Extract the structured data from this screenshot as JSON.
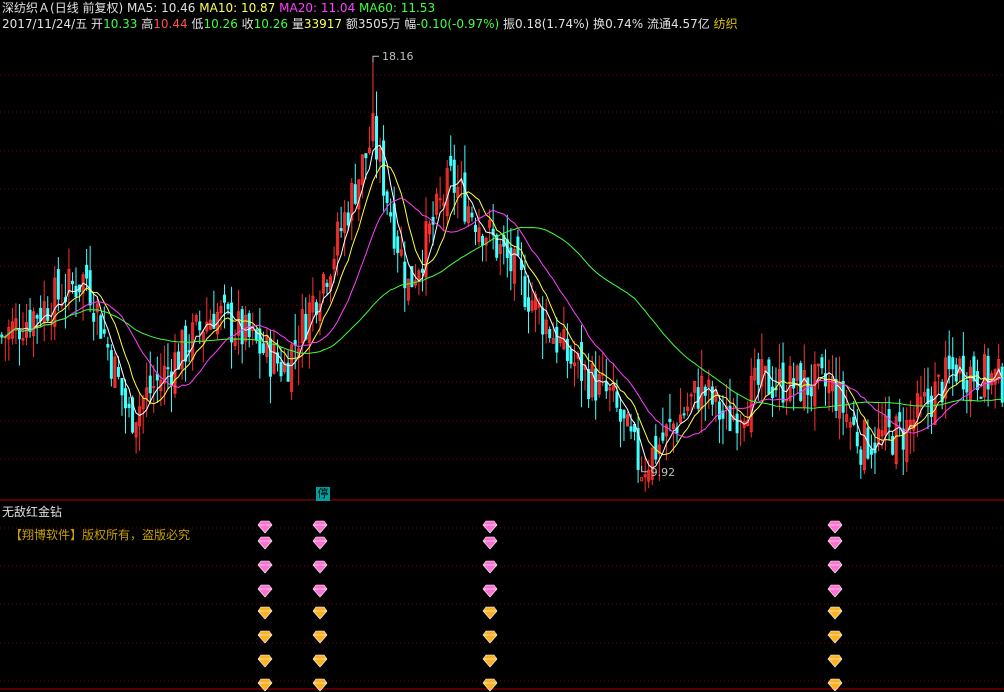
{
  "header": {
    "stock_name": "深纺织Ａ",
    "period": "(日线 前复权)",
    "ma5_label": "MA5: 10.46",
    "ma10_label": "MA10: 10.87",
    "ma20_label": "MA20: 11.04",
    "ma60_label": "MA60: 11.53",
    "date": "2017/11/24/五",
    "open_label": "开",
    "open_value": "10.33",
    "high_label": "高",
    "high_value": "10.44",
    "low_label": "低",
    "low_value": "10.26",
    "close_label": "收",
    "close_value": "10.26",
    "volume_label": "量",
    "volume_value": "33917",
    "amount_label": "额",
    "amount_value": "3505万",
    "change_label": "幅",
    "change_value": "-0.10(-0.97%)",
    "amplitude_label": "振",
    "amplitude_value": "0.18(1.74%)",
    "turnover_label": "换",
    "turnover_value": "0.74%",
    "float_label": "流通",
    "float_value": "4.57亿",
    "industry": "纺织"
  },
  "colors": {
    "up": "#ff3030",
    "down": "#40ffff",
    "ma5": "#ffffff",
    "ma10": "#ffff40",
    "ma20": "#ff40ff",
    "ma60": "#40ff40",
    "grid": "#800000",
    "divider": "#b00000",
    "gem_pink": "#ff70d0",
    "gem_gold": "#ffb020"
  },
  "sub_panel": {
    "title": "无敌红金钻",
    "copyright": "【翔博软件】版权所有，盗版必究",
    "stop_label": "停"
  },
  "chart_data": {
    "type": "candlestick",
    "high_annotation": "18.16",
    "low_annotation": "9.92",
    "ylim": [
      9.4,
      18.6
    ],
    "grid": true,
    "key_points": [
      {
        "index": 0,
        "close": 12.6
      },
      {
        "index": 24,
        "close": 13.8
      },
      {
        "index": 36,
        "close": 11.0
      },
      {
        "index": 60,
        "close": 13.1
      },
      {
        "index": 80,
        "close": 12.0
      },
      {
        "index": 94,
        "close": 14.3
      },
      {
        "index": 100,
        "close": 15.6
      },
      {
        "index": 105,
        "close": 16.6
      },
      {
        "index": 115,
        "close": 13.6
      },
      {
        "index": 127,
        "close": 15.7
      },
      {
        "index": 145,
        "close": 13.9
      },
      {
        "index": 160,
        "close": 12.2
      },
      {
        "index": 172,
        "close": 11.4
      },
      {
        "index": 181,
        "close": 10.0
      },
      {
        "index": 198,
        "close": 11.6
      },
      {
        "index": 205,
        "close": 10.9
      },
      {
        "index": 215,
        "close": 11.7
      },
      {
        "index": 235,
        "close": 11.6
      },
      {
        "index": 243,
        "close": 10.5
      },
      {
        "index": 255,
        "close": 10.7
      },
      {
        "index": 270,
        "close": 12.0
      },
      {
        "index": 283,
        "close": 11.7
      }
    ],
    "signal_columns": [
      265,
      320,
      490,
      835
    ],
    "signal_rows": {
      "pink": 4,
      "gold": 4
    }
  }
}
